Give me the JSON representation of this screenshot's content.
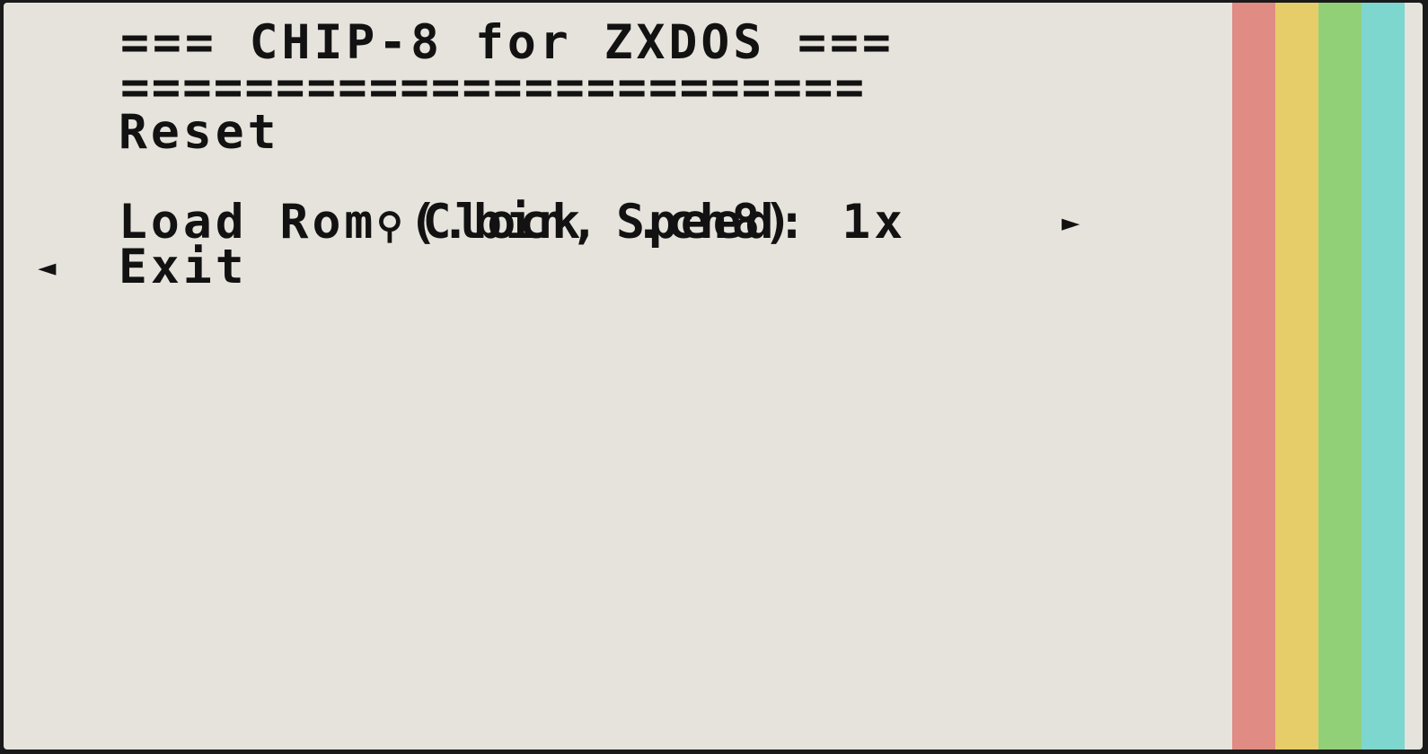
{
  "app": {
    "title": "=== CHIP-8 for ZXDOS ===",
    "separator": "========================"
  },
  "menu": {
    "items": [
      {
        "label": "Reset"
      },
      {
        "icon": "dial-icon",
        "icon_glyph": "⚲",
        "label": "Clock Speed: 1x"
      },
      {
        "label": "Load Rom (.bin, .ch8)",
        "submenu_marker": "►"
      },
      {
        "label": "Exit",
        "selection_marker": "◄"
      }
    ]
  },
  "colors": {
    "background": "#e6e3dc",
    "text": "#121212",
    "stripes": [
      "#e08b84",
      "#e7cd6a",
      "#92d078",
      "#7dd7cf"
    ]
  }
}
